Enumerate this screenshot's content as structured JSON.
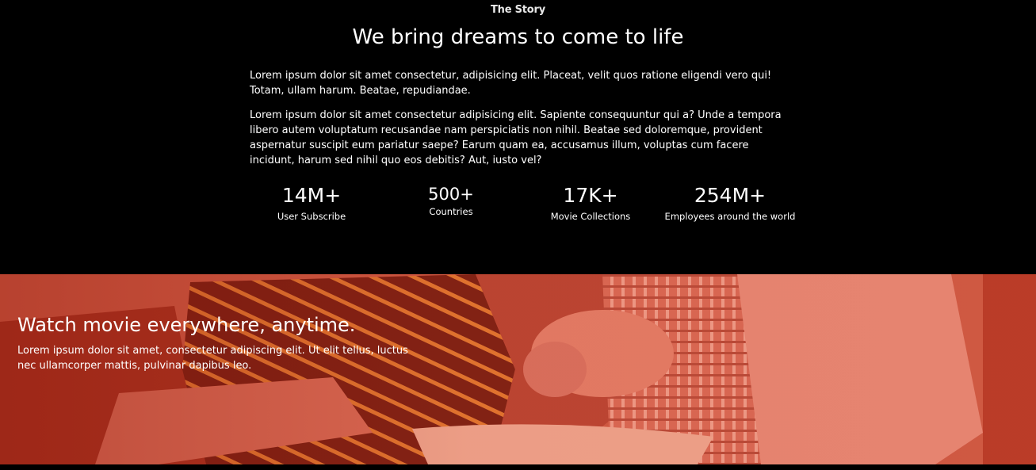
{
  "story": {
    "eyebrow": "The Story",
    "headline": "We bring dreams to come to life",
    "paragraphs": [
      "Lorem ipsum dolor sit amet consectetur, adipisicing elit. Placeat, velit quos ratione eligendi vero qui! Totam, ullam harum. Beatae, repudiandae.",
      "Lorem ipsum dolor sit amet consectetur adipisicing elit. Sapiente consequuntur qui a? Unde a tempora libero autem voluptatum recusandae nam perspiciatis non nihil. Beatae sed doloremque, provident aspernatur suscipit eum pariatur saepe? Earum quam ea, accusamus illum, voluptas cum facere incidunt, harum sed nihil quo eos debitis? Aut, iusto vel?"
    ],
    "stats": [
      {
        "value": "14M+",
        "label": "User Subscribe"
      },
      {
        "value": "500+",
        "label": "Countries"
      },
      {
        "value": "17K+",
        "label": "Movie Collections"
      },
      {
        "value": "254M+",
        "label": "Employees around the world"
      }
    ]
  },
  "hero": {
    "title": "Watch movie everywhere, anytime.",
    "text": "Lorem ipsum dolor sit amet, consectetur adipiscing elit. Ut elit tellus, luctus nec ullamcorper mattis, pulvinar dapibus leo.",
    "image_label": "family-popcorn-photo",
    "tint_color": "#c8452e"
  },
  "colors": {
    "background": "#000000",
    "text": "#ffffff",
    "accent": "#c8452e"
  }
}
